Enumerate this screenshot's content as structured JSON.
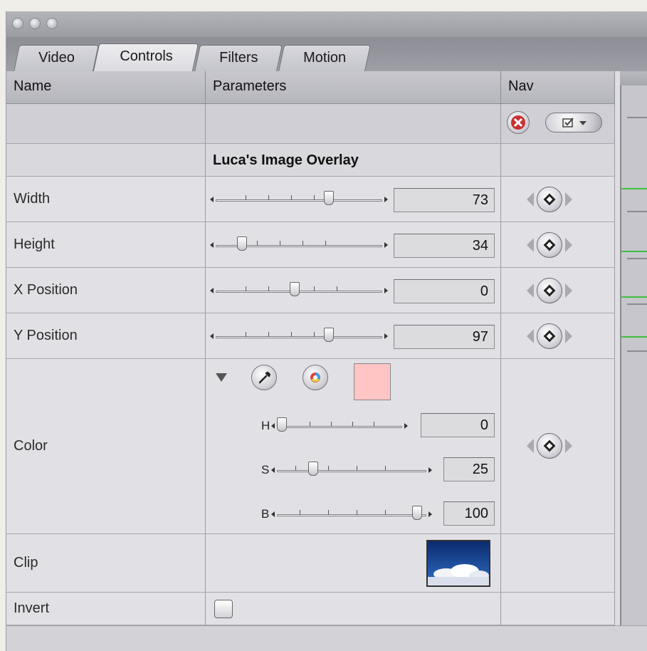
{
  "tabs": [
    {
      "label": "Video"
    },
    {
      "label": "Controls"
    },
    {
      "label": "Filters"
    },
    {
      "label": "Motion"
    }
  ],
  "columns": {
    "name": "Name",
    "parameters": "Parameters",
    "nav": "Nav"
  },
  "filter_title": "Luca's Image Overlay",
  "params": {
    "width": {
      "label": "Width",
      "value": "73"
    },
    "height": {
      "label": "Height",
      "value": "34"
    },
    "x_position": {
      "label": "X Position",
      "value": "0"
    },
    "y_position": {
      "label": "Y Position",
      "value": "97"
    }
  },
  "color": {
    "label": "Color",
    "swatch": "#ffc4c4",
    "h": {
      "label": "H",
      "value": "0"
    },
    "s": {
      "label": "S",
      "value": "25"
    },
    "b": {
      "label": "B",
      "value": "100"
    }
  },
  "clip": {
    "label": "Clip"
  },
  "invert": {
    "label": "Invert",
    "checked": false
  },
  "icons": [
    "close-window-light",
    "reset-x-icon",
    "checkbox-menu-icon",
    "eyedropper-icon",
    "color-wheel-icon",
    "keyframe-nav-icon"
  ],
  "accent_colors": {
    "reset": "#c83232",
    "timeline_green": "#3fbf3f"
  }
}
